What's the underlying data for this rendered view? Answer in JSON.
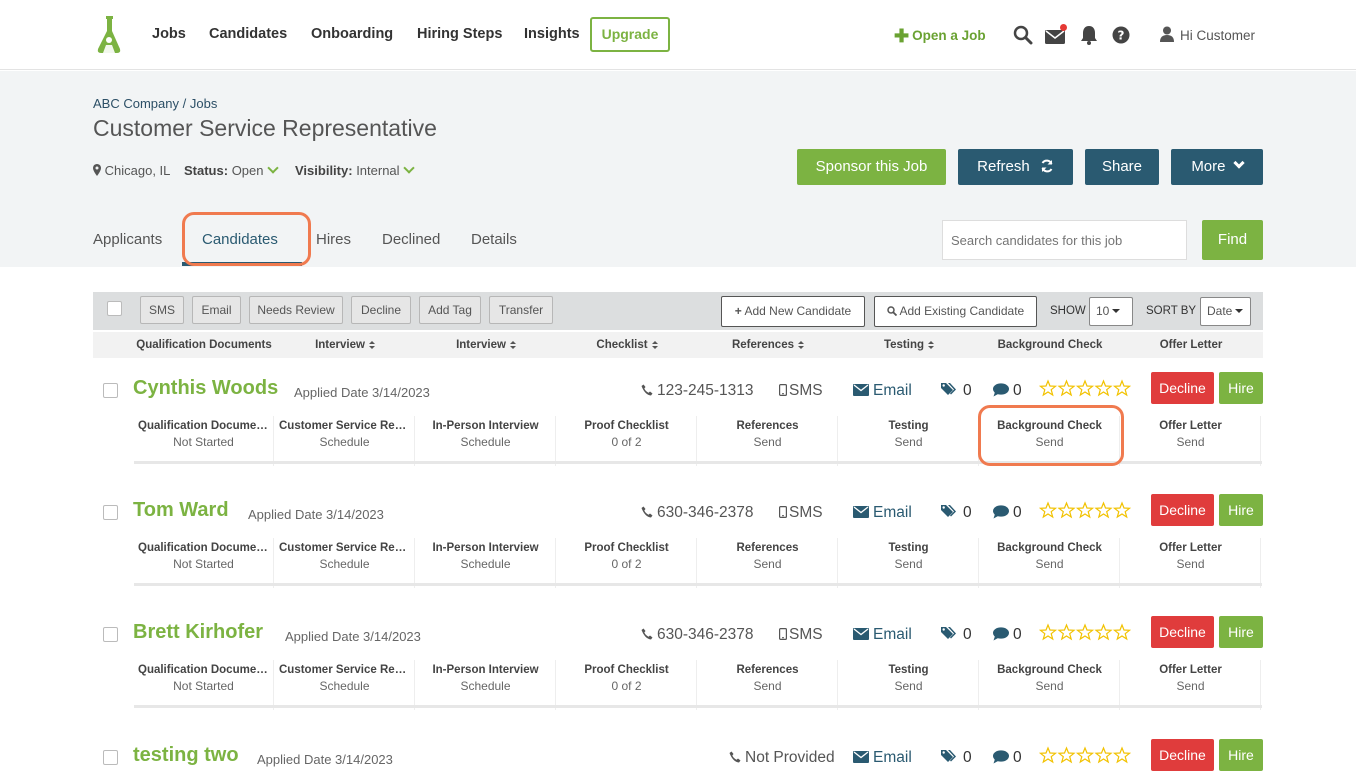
{
  "nav": {
    "items": [
      "Jobs",
      "Candidates",
      "Onboarding",
      "Hiring Steps",
      "Insights"
    ],
    "upgrade": "Upgrade",
    "open_job": "Open a Job",
    "greeting": "Hi Customer",
    "icons": [
      "search-icon",
      "mail-icon",
      "bell-icon",
      "help-icon",
      "user-icon"
    ],
    "colors": {
      "brand_green": "#7cb342",
      "navy": "#2a5a71",
      "red": "#e03c3c",
      "notification": "#e53935"
    }
  },
  "job": {
    "breadcrumb": [
      "ABC Company",
      "Jobs"
    ],
    "breadcrumb_sep": "/",
    "title": "Customer Service Representative",
    "location": "Chicago, IL",
    "status_label": "Status:",
    "status_value": "Open",
    "visibility_label": "Visibility:",
    "visibility_value": "Internal",
    "buttons": {
      "sponsor": "Sponsor this Job",
      "refresh": "Refresh",
      "share": "Share",
      "more": "More"
    }
  },
  "tabs": {
    "items": [
      "Applicants",
      "Candidates",
      "Hires",
      "Declined",
      "Details"
    ],
    "active": "Candidates"
  },
  "search": {
    "placeholder": "Search candidates for this job",
    "button": "Find"
  },
  "toolbar": {
    "actions": [
      "SMS",
      "Email",
      "Needs Review",
      "Decline",
      "Add Tag",
      "Transfer"
    ],
    "add_new": "Add New Candidate",
    "add_existing": "Add Existing Candidate",
    "show_label": "SHOW",
    "show_value": "10",
    "sort_label": "SORT BY",
    "sort_value": "Date"
  },
  "columns": [
    "Qualification Documents",
    "Interview",
    "Interview",
    "Checklist",
    "References",
    "Testing",
    "Background Check",
    "Offer Letter"
  ],
  "step_titles": [
    "Qualification Documents",
    "Customer Service Repr...",
    "In-Person Interview",
    "Proof Checklist",
    "References",
    "Testing",
    "Background Check",
    "Offer Letter"
  ],
  "candidates": [
    {
      "name": "Cynthis Woods",
      "applied": "Applied Date 3/14/2023",
      "phone": "123-245-1313",
      "sms": "SMS",
      "email": "Email",
      "tags": "0",
      "messages": "0",
      "rating": 0,
      "decline": "Decline",
      "hire": "Hire",
      "steps": [
        "Not Started",
        "Schedule",
        "Schedule",
        "0 of 2",
        "Send",
        "Send",
        "Send",
        "Send"
      ]
    },
    {
      "name": "Tom Ward",
      "applied": "Applied Date 3/14/2023",
      "phone": "630-346-2378",
      "sms": "SMS",
      "email": "Email",
      "tags": "0",
      "messages": "0",
      "rating": 0,
      "decline": "Decline",
      "hire": "Hire",
      "steps": [
        "Not Started",
        "Schedule",
        "Schedule",
        "0 of 2",
        "Send",
        "Send",
        "Send",
        "Send"
      ]
    },
    {
      "name": "Brett Kirhofer",
      "applied": "Applied Date 3/14/2023",
      "phone": "630-346-2378",
      "sms": "SMS",
      "email": "Email",
      "tags": "0",
      "messages": "0",
      "rating": 0,
      "decline": "Decline",
      "hire": "Hire",
      "steps": [
        "Not Started",
        "Schedule",
        "Schedule",
        "0 of 2",
        "Send",
        "Send",
        "Send",
        "Send"
      ]
    },
    {
      "name": "testing two",
      "applied": "Applied Date 3/14/2023",
      "phone": "Not Provided",
      "email": "Email",
      "tags": "0",
      "messages": "0",
      "rating": 0,
      "decline": "Decline",
      "hire": "Hire"
    }
  ]
}
